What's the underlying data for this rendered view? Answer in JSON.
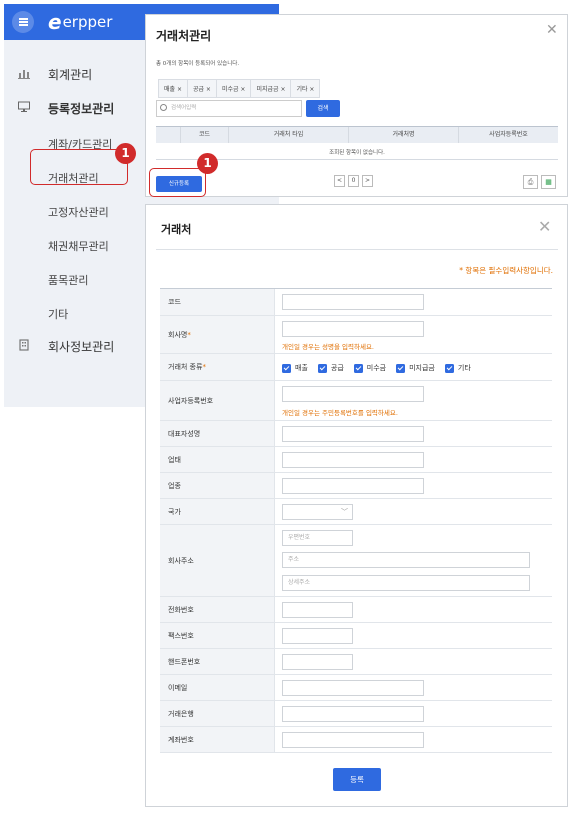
{
  "sidebar": {
    "brand": "erpper",
    "brand_mark": "e",
    "items": [
      {
        "label": "회계관리",
        "icon": "chart-icon"
      },
      {
        "label": "등록정보관리",
        "icon": "monitor-icon"
      },
      {
        "label": "회사정보관리",
        "icon": "building-icon"
      }
    ],
    "sub_items": [
      "계좌/카드관리",
      "거래처관리",
      "고정자산관리",
      "채권채무관리",
      "품목관리",
      "기타"
    ]
  },
  "badges": [
    "1",
    "1"
  ],
  "list_window": {
    "title": "거래처관리",
    "count_text": "총 0개의 항목이 등록되어 있습니다.",
    "tags": [
      "매출 ×",
      "공급 ×",
      "미수금 ×",
      "미지급금 ×",
      "기타 ×"
    ],
    "search_placeholder": "검색어입력",
    "search_button": "검색",
    "columns": [
      "",
      "코드",
      "거래처 타입",
      "거래처명",
      "사업자등록번호"
    ],
    "empty_message": "조회된 항목이 없습니다.",
    "new_button": "신규등록",
    "pager": {
      "prev": "<",
      "page": "0",
      "next": ">"
    }
  },
  "form_window": {
    "title": "거래처",
    "required_note": "* 항목은 필수입력사항입니다.",
    "labels": {
      "code": "코드",
      "company": "회사명",
      "type": "거래처 종류",
      "bizno": "사업자등록번호",
      "ceo": "대표자성명",
      "biz_type": "업태",
      "biz_item": "업종",
      "country": "국가",
      "address": "회사주소",
      "phone": "전화번호",
      "fax": "팩스번호",
      "mobile": "핸드폰번호",
      "email": "이메일",
      "bank": "거래은행",
      "account": "계좌번호"
    },
    "required_mark": "*",
    "company_hint": "개인일 경우는 성명을 입력하세요.",
    "bizno_hint": "개인일 경우는 주민등록번호를 입력하세요.",
    "type_options": [
      "매출",
      "공급",
      "미수금",
      "미지급금",
      "기타"
    ],
    "address_placeholders": {
      "zip": "우편번호",
      "addr": "주소",
      "detail": "상세주소"
    },
    "submit_button": "등록"
  },
  "colors": {
    "accent": "#2f6ae0",
    "highlight": "#d12b2b",
    "warning": "#e06e00"
  }
}
